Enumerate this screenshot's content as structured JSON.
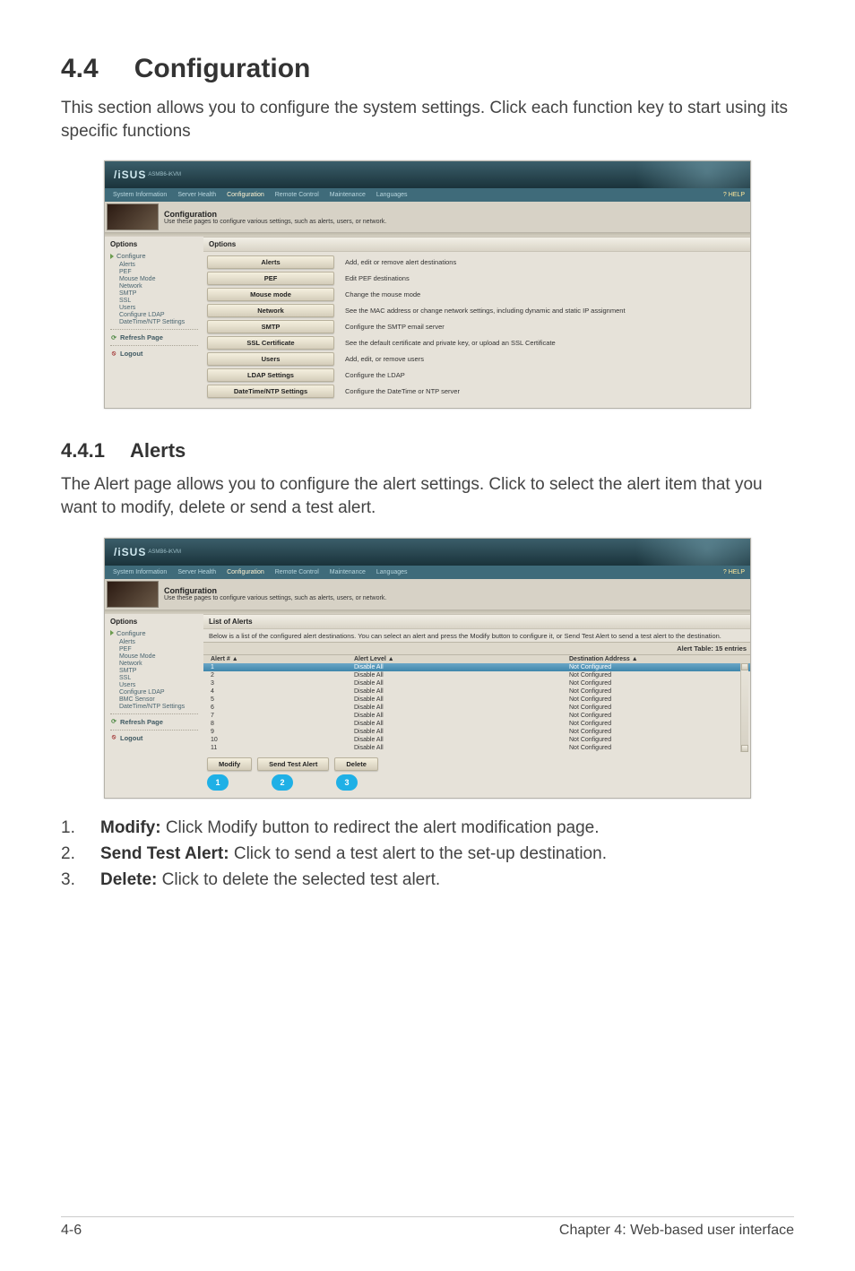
{
  "heading": {
    "number": "4.4",
    "title": "Configuration"
  },
  "intro": "This section allows you to configure the system settings. Click each function key to start using its specific functions",
  "screenshot1": {
    "brand": "/iSUS",
    "subbrand": "ASMB6-iKVM",
    "nav": [
      "System Information",
      "Server Health",
      "Configuration",
      "Remote Control",
      "Maintenance",
      "Languages"
    ],
    "help": "? HELP",
    "header_title": "Configuration",
    "header_sub": "Use these pages to configure various settings, such as alerts, users, or network.",
    "panel_title": "Options",
    "side_title": "Options",
    "side_group": "Configure",
    "side_items": [
      "Alerts",
      "PEF",
      "Mouse Mode",
      "Network",
      "SMTP",
      "SSL",
      "Users",
      "Configure LDAP",
      "DateTime/NTP Settings"
    ],
    "side_refresh": "Refresh Page",
    "side_logout": "Logout",
    "rows": [
      {
        "label": "Alerts",
        "desc": "Add, edit or remove alert destinations"
      },
      {
        "label": "PEF",
        "desc": "Edit PEF destinations"
      },
      {
        "label": "Mouse mode",
        "desc": "Change the mouse mode"
      },
      {
        "label": "Network",
        "desc": "See the MAC address or change network settings, including dynamic and static IP assignment"
      },
      {
        "label": "SMTP",
        "desc": "Configure the SMTP email server"
      },
      {
        "label": "SSL Certificate",
        "desc": "See the default certificate and private key, or upload an SSL Certificate"
      },
      {
        "label": "Users",
        "desc": "Add, edit, or remove users"
      },
      {
        "label": "LDAP Settings",
        "desc": "Configure the LDAP"
      },
      {
        "label": "DateTime/NTP Settings",
        "desc": "Configure the DateTime or NTP server"
      }
    ]
  },
  "subheading": {
    "number": "4.4.1",
    "title": "Alerts"
  },
  "sub_intro": "The Alert page allows you to configure the alert settings. Click to select the alert item that you want to modify, delete or send a test alert.",
  "screenshot2": {
    "brand": "/iSUS",
    "subbrand": "ASMB6-iKVM",
    "nav": [
      "System Information",
      "Server Health",
      "Configuration",
      "Remote Control",
      "Maintenance",
      "Languages"
    ],
    "help": "? HELP",
    "header_title": "Configuration",
    "header_sub": "Use these pages to configure various settings, such as alerts, users, or network.",
    "panel_title": "List of Alerts",
    "side_title": "Options",
    "side_group": "Configure",
    "side_items": [
      "Alerts",
      "PEF",
      "Mouse Mode",
      "Network",
      "SMTP",
      "SSL",
      "Users",
      "Configure LDAP",
      "BMC Sensor",
      "DateTime/NTP Settings"
    ],
    "side_refresh": "Refresh Page",
    "side_logout": "Logout",
    "intro_line": "Below is a list of the configured alert destinations. You can select an alert and press the Modify button to configure it, or Send Test Alert to send a test alert to the destination.",
    "table_count": "Alert Table: 15 entries",
    "cols": [
      "Alert # ▲",
      "Alert Level ▲",
      "Destination Address ▲"
    ],
    "rows": [
      {
        "n": "1",
        "level": "Disable All",
        "dest": "Not Configured",
        "selected": true
      },
      {
        "n": "2",
        "level": "Disable All",
        "dest": "Not Configured"
      },
      {
        "n": "3",
        "level": "Disable All",
        "dest": "Not Configured"
      },
      {
        "n": "4",
        "level": "Disable All",
        "dest": "Not Configured"
      },
      {
        "n": "5",
        "level": "Disable All",
        "dest": "Not Configured"
      },
      {
        "n": "6",
        "level": "Disable All",
        "dest": "Not Configured"
      },
      {
        "n": "7",
        "level": "Disable All",
        "dest": "Not Configured"
      },
      {
        "n": "8",
        "level": "Disable All",
        "dest": "Not Configured"
      },
      {
        "n": "9",
        "level": "Disable All",
        "dest": "Not Configured"
      },
      {
        "n": "10",
        "level": "Disable All",
        "dest": "Not Configured"
      },
      {
        "n": "11",
        "level": "Disable All",
        "dest": "Not Configured"
      }
    ],
    "buttons": [
      "Modify",
      "Send Test Alert",
      "Delete"
    ],
    "callouts": [
      "1",
      "2",
      "3"
    ]
  },
  "list": [
    {
      "n": "1.",
      "bold": "Modify:",
      "text": " Click Modify button to redirect the alert modification page."
    },
    {
      "n": "2.",
      "bold": "Send Test Alert:",
      "text": " Click to send a test alert to the set-up destination."
    },
    {
      "n": "3.",
      "bold": "Delete:",
      "text": " Click to delete the selected test alert."
    }
  ],
  "footer": {
    "left": "4-6",
    "right": "Chapter 4: Web-based user interface"
  }
}
